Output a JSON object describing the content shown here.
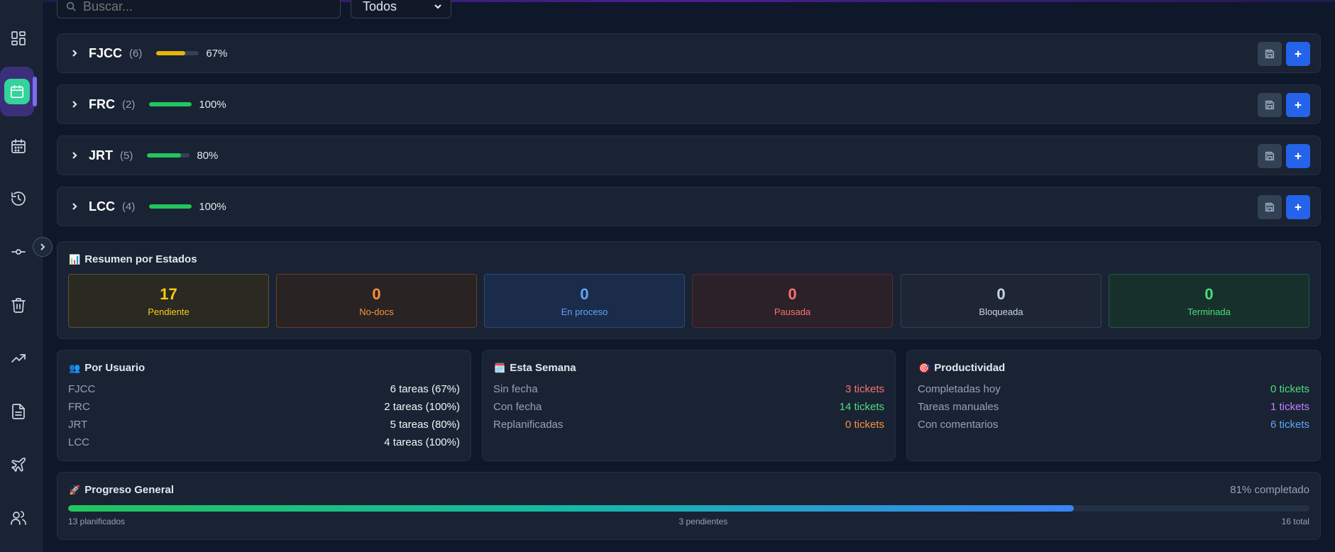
{
  "filters": {
    "search_placeholder": "Buscar...",
    "status_select_value": "Todos"
  },
  "groups": [
    {
      "name": "FJCC",
      "count": "(6)",
      "progress_pct": 67,
      "progress_label": "67%",
      "bar_color": "#eab308"
    },
    {
      "name": "FRC",
      "count": "(2)",
      "progress_pct": 100,
      "progress_label": "100%",
      "bar_color": "#22c55e"
    },
    {
      "name": "JRT",
      "count": "(5)",
      "progress_pct": 80,
      "progress_label": "80%",
      "bar_color": "#22c55e"
    },
    {
      "name": "LCC",
      "count": "(4)",
      "progress_pct": 100,
      "progress_label": "100%",
      "bar_color": "#22c55e"
    }
  ],
  "estados": {
    "title": "Resumen por Estados",
    "icon": "bar-chart-emoji",
    "cards": [
      {
        "value": "17",
        "label": "Pendiente",
        "color": "#facc15",
        "bg": "#2a2a22",
        "border": "#5c5430"
      },
      {
        "value": "0",
        "label": "No-docs",
        "color": "#fb923c",
        "bg": "#2a2323",
        "border": "#6b3e24"
      },
      {
        "value": "0",
        "label": "En proceso",
        "color": "#60a5fa",
        "bg": "#1b2b4a",
        "border": "#2c4a7a"
      },
      {
        "value": "0",
        "label": "Pausada",
        "color": "#f87171",
        "bg": "#2b2129",
        "border": "#5c2a33"
      },
      {
        "value": "0",
        "label": "Bloqueada",
        "color": "#cbd5e1",
        "bg": "#1e2636",
        "border": "#334155"
      },
      {
        "value": "0",
        "label": "Terminada",
        "color": "#4ade80",
        "bg": "#18302c",
        "border": "#1f5a45"
      }
    ]
  },
  "por_usuario": {
    "title": "Por Usuario",
    "icon": "users-emoji",
    "rows": [
      {
        "user": "FJCC",
        "value": "6 tareas (67%)"
      },
      {
        "user": "FRC",
        "value": "2 tareas (100%)"
      },
      {
        "user": "JRT",
        "value": "5 tareas (80%)"
      },
      {
        "user": "LCC",
        "value": "4 tareas (100%)"
      }
    ]
  },
  "esta_semana": {
    "title": "Esta Semana",
    "icon": "calendar-emoji",
    "rows": [
      {
        "label": "Sin fecha",
        "value": "3 tickets",
        "color": "#f87171"
      },
      {
        "label": "Con fecha",
        "value": "14 tickets",
        "color": "#4ade80"
      },
      {
        "label": "Replanificadas",
        "value": "0 tickets",
        "color": "#fb923c"
      }
    ]
  },
  "productividad": {
    "title": "Productividad",
    "icon": "target-emoji",
    "rows": [
      {
        "label": "Completadas hoy",
        "value": "0 tickets",
        "color": "#4ade80"
      },
      {
        "label": "Tareas manuales",
        "value": "1 tickets",
        "color": "#c084fc"
      },
      {
        "label": "Con comentarios",
        "value": "6 tickets",
        "color": "#60a5fa"
      }
    ]
  },
  "progreso": {
    "title": "Progreso General",
    "icon": "rocket-emoji",
    "completed_label": "81% completado",
    "fill_pct": 81,
    "planned": "13 planificados",
    "pending": "3 pendientes",
    "total": "16 total"
  },
  "sidebar": {
    "items": [
      "dashboard-icon",
      "calendar-active-icon",
      "calendar-icon",
      "history-icon",
      "commit-icon",
      "trash-icon",
      "trending-up-icon",
      "document-icon",
      "plane-icon",
      "users-icon"
    ],
    "active_index": 1
  }
}
